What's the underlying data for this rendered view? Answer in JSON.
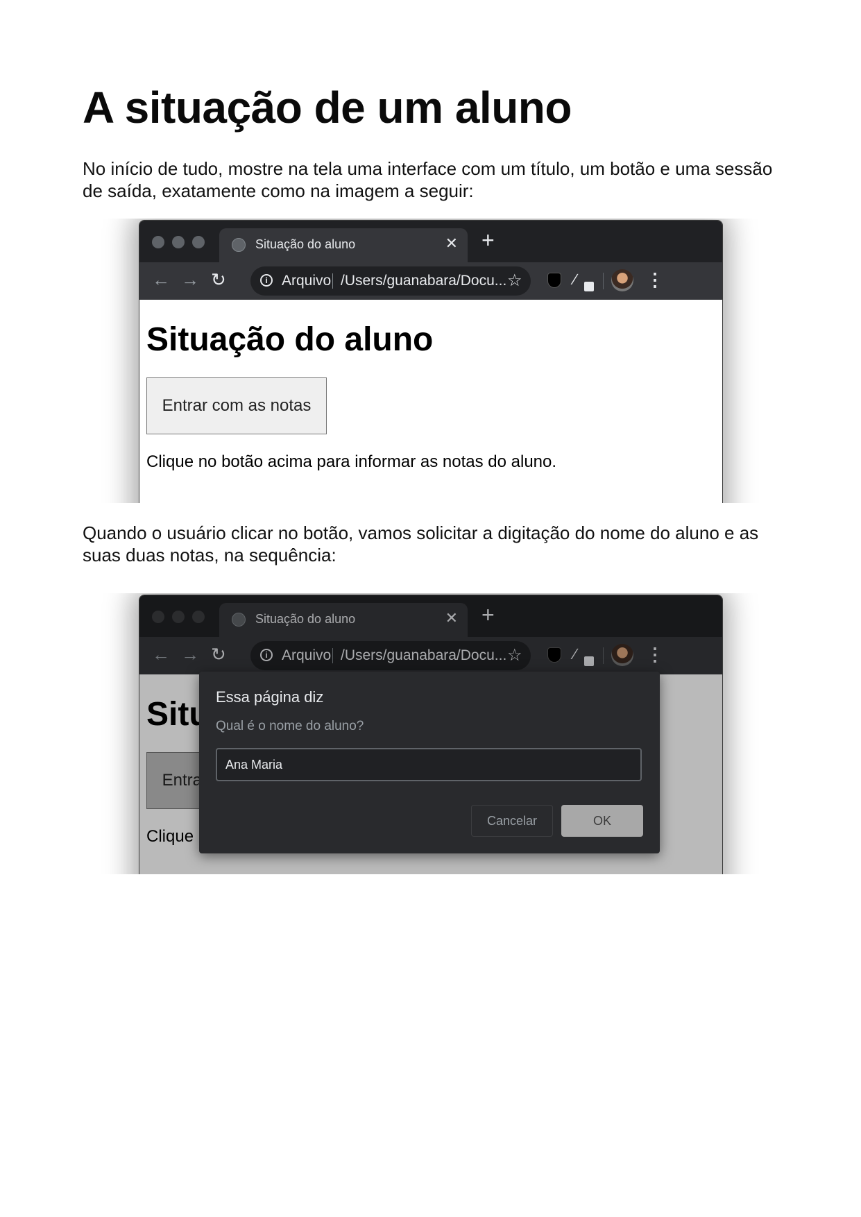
{
  "document": {
    "title": "A situação de um aluno",
    "paragraph_1": "No início de tudo, mostre na tela uma interface com um título, um botão e uma sessão de saída, exatamente como na imagem a seguir:",
    "paragraph_2": "Quando o usuário clicar no botão, vamos solicitar a digitação do nome do aluno e as suas duas notas, na sequência:"
  },
  "browser": {
    "tab_title": "Situação do aluno",
    "tab_close": "✕",
    "new_tab": "+",
    "scheme_label": "Arquivo",
    "url": "/Users/guanabara/Docu...",
    "back": "←",
    "forward": "→",
    "reload": "↻",
    "star": "☆",
    "kebab": "⋮",
    "pen": "∕"
  },
  "page": {
    "heading": "Situação do aluno",
    "button_label": "Entrar com as notas",
    "output_text": "Clique no botão acima para informar as notas do aluno."
  },
  "prompt_dialog": {
    "title": "Essa página diz",
    "message": "Qual é o nome do aluno?",
    "input_value": "Ana Maria",
    "cancel_label": "Cancelar",
    "ok_label": "OK"
  },
  "colors": {
    "chrome_dark": "#202124",
    "chrome_toolbar": "#35363a",
    "dialog_bg": "#292a2d"
  }
}
